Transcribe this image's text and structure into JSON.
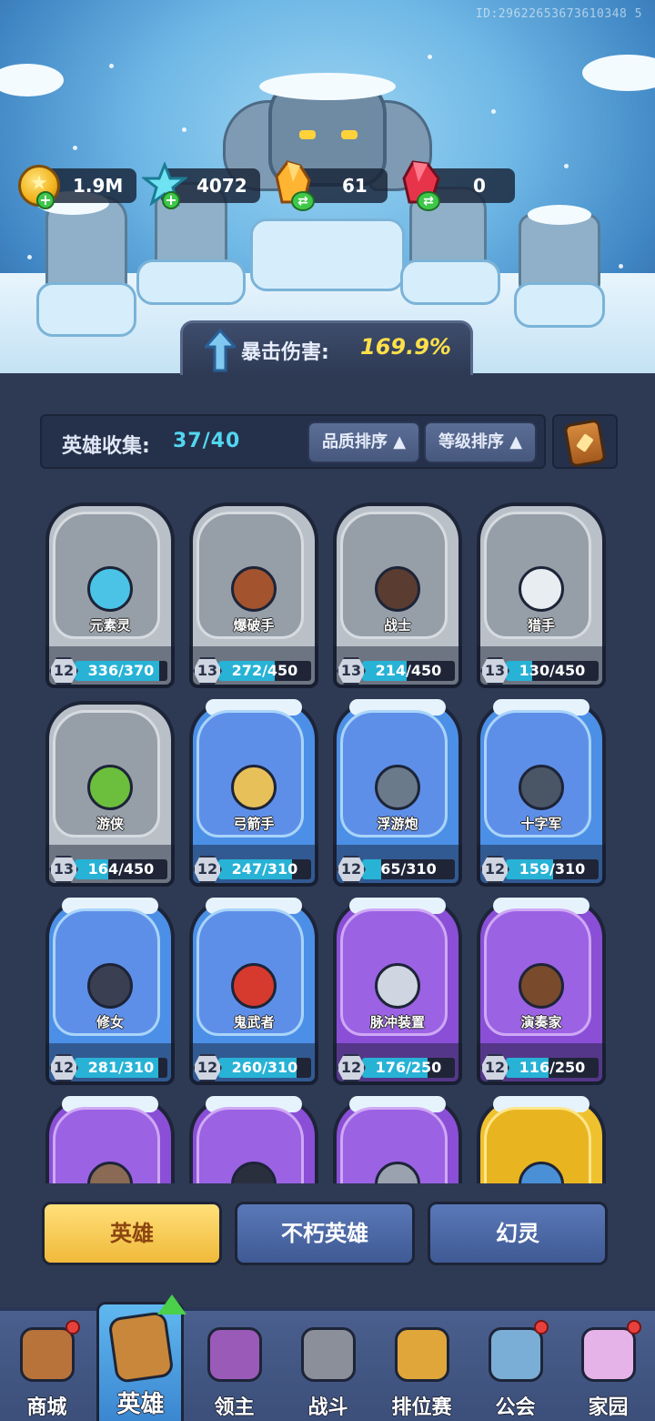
{
  "account_id": "ID:29622653673610348 5",
  "resources": {
    "gold": "1.9M",
    "diamond": "4072",
    "orange_crystal": "61",
    "red_crystal": "0"
  },
  "crit": {
    "label": "暴击伤害:",
    "value": "169.9%"
  },
  "collection": {
    "label": "英雄收集:",
    "value": "37/40",
    "sort_quality": "品质排序 ▲",
    "sort_level": "等级排序 ▲"
  },
  "heroes": [
    {
      "name": "元素灵",
      "level": "12",
      "progress": "336/370",
      "fill": 0.908,
      "rarity": "gray",
      "portrait": "#4ac3e6"
    },
    {
      "name": "爆破手",
      "level": "13",
      "progress": "272/450",
      "fill": 0.604,
      "rarity": "gray",
      "portrait": "#a3532e"
    },
    {
      "name": "战士",
      "level": "13",
      "progress": "214/450",
      "fill": 0.476,
      "rarity": "gray",
      "portrait": "#5a3d30"
    },
    {
      "name": "猎手",
      "level": "13",
      "progress": "130/450",
      "fill": 0.289,
      "rarity": "gray",
      "portrait": "#e8edf2"
    },
    {
      "name": "游侠",
      "level": "13",
      "progress": "164/450",
      "fill": 0.364,
      "rarity": "gray",
      "portrait": "#6bbf3c"
    },
    {
      "name": "弓箭手",
      "level": "12",
      "progress": "247/310",
      "fill": 0.797,
      "rarity": "blue",
      "portrait": "#e8c05a"
    },
    {
      "name": "浮游炮",
      "level": "12",
      "progress": "65/310",
      "fill": 0.21,
      "rarity": "blue",
      "portrait": "#6b7a8a"
    },
    {
      "name": "十字军",
      "level": "12",
      "progress": "159/310",
      "fill": 0.513,
      "rarity": "blue",
      "portrait": "#4a5566"
    },
    {
      "name": "修女",
      "level": "12",
      "progress": "281/310",
      "fill": 0.906,
      "rarity": "blue",
      "portrait": "#3a3f52"
    },
    {
      "name": "鬼武者",
      "level": "12",
      "progress": "260/310",
      "fill": 0.839,
      "rarity": "blue",
      "portrait": "#d63a2e"
    },
    {
      "name": "脉冲装置",
      "level": "12",
      "progress": "176/250",
      "fill": 0.704,
      "rarity": "purple",
      "portrait": "#cfd6e2"
    },
    {
      "name": "演奏家",
      "level": "12",
      "progress": "116/250",
      "fill": 0.464,
      "rarity": "purple",
      "portrait": "#7a4a2c"
    },
    {
      "name": "",
      "level": "",
      "progress": "",
      "fill": 0,
      "rarity": "purple",
      "portrait": "#8a6a55"
    },
    {
      "name": "",
      "level": "",
      "progress": "",
      "fill": 0,
      "rarity": "purple",
      "portrait": "#2a2f3e"
    },
    {
      "name": "",
      "level": "",
      "progress": "",
      "fill": 0,
      "rarity": "purple",
      "portrait": "#9aa2b0"
    },
    {
      "name": "",
      "level": "",
      "progress": "",
      "fill": 0,
      "rarity": "gold",
      "portrait": "#4a90d6"
    }
  ],
  "tabs": {
    "heroes": "英雄",
    "immortal": "不朽英雄",
    "phantom": "幻灵"
  },
  "nav": [
    {
      "label": "商城",
      "icon": "shop-chest-icon",
      "color": "#b8733a",
      "dot": true
    },
    {
      "label": "英雄",
      "icon": "hero-card-icon",
      "color": "#c8873a",
      "dot": false,
      "active": true
    },
    {
      "label": "领主",
      "icon": "lord-banner-icon",
      "color": "#9a5ab8",
      "dot": false
    },
    {
      "label": "战斗",
      "icon": "battle-weapons-icon",
      "color": "#8a8f99",
      "dot": false
    },
    {
      "label": "排位赛",
      "icon": "ranked-shield-icon",
      "color": "#e0a63a",
      "dot": false
    },
    {
      "label": "公会",
      "icon": "guild-castle-icon",
      "color": "#7aaed6",
      "dot": true
    },
    {
      "label": "家园",
      "icon": "home-castle-icon",
      "color": "#e6b3e8",
      "dot": true
    }
  ]
}
